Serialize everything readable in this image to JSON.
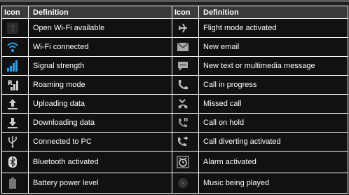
{
  "table": {
    "headers": [
      "Icon",
      "Definition",
      "Icon",
      "Definition"
    ],
    "rows": [
      {
        "left": {
          "icon": "open-wifi-icon",
          "text": "Open Wi-Fi available"
        },
        "right": {
          "icon": "flight-mode-icon",
          "text": "Flight mode activated"
        }
      },
      {
        "left": {
          "icon": "wifi-connected-icon",
          "text": "Wi-Fi connected"
        },
        "right": {
          "icon": "email-icon",
          "text": "New email"
        }
      },
      {
        "left": {
          "icon": "signal-strength-icon",
          "text": "Signal strength"
        },
        "right": {
          "icon": "message-icon",
          "text": "New text or multimedia message"
        }
      },
      {
        "left": {
          "icon": "roaming-icon",
          "text": "Roaming mode"
        },
        "right": {
          "icon": "call-in-progress-icon",
          "text": "Call in progress"
        }
      },
      {
        "left": {
          "icon": "upload-icon",
          "text": "Uploading data"
        },
        "right": {
          "icon": "missed-call-icon",
          "text": "Missed call"
        }
      },
      {
        "left": {
          "icon": "download-icon",
          "text": "Downloading data"
        },
        "right": {
          "icon": "call-on-hold-icon",
          "text": "Call on hold"
        }
      },
      {
        "left": {
          "icon": "usb-icon",
          "text": "Connected to PC"
        },
        "right": {
          "icon": "call-divert-icon",
          "text": "Call diverting activated"
        }
      },
      {
        "left": {
          "icon": "bluetooth-icon",
          "text": "Bluetooth activated"
        },
        "right": {
          "icon": "alarm-icon",
          "text": "Alarm activated"
        }
      },
      {
        "left": {
          "icon": "battery-icon",
          "text": "Battery power level"
        },
        "right": {
          "icon": "music-icon",
          "text": "Music being played"
        }
      }
    ]
  }
}
